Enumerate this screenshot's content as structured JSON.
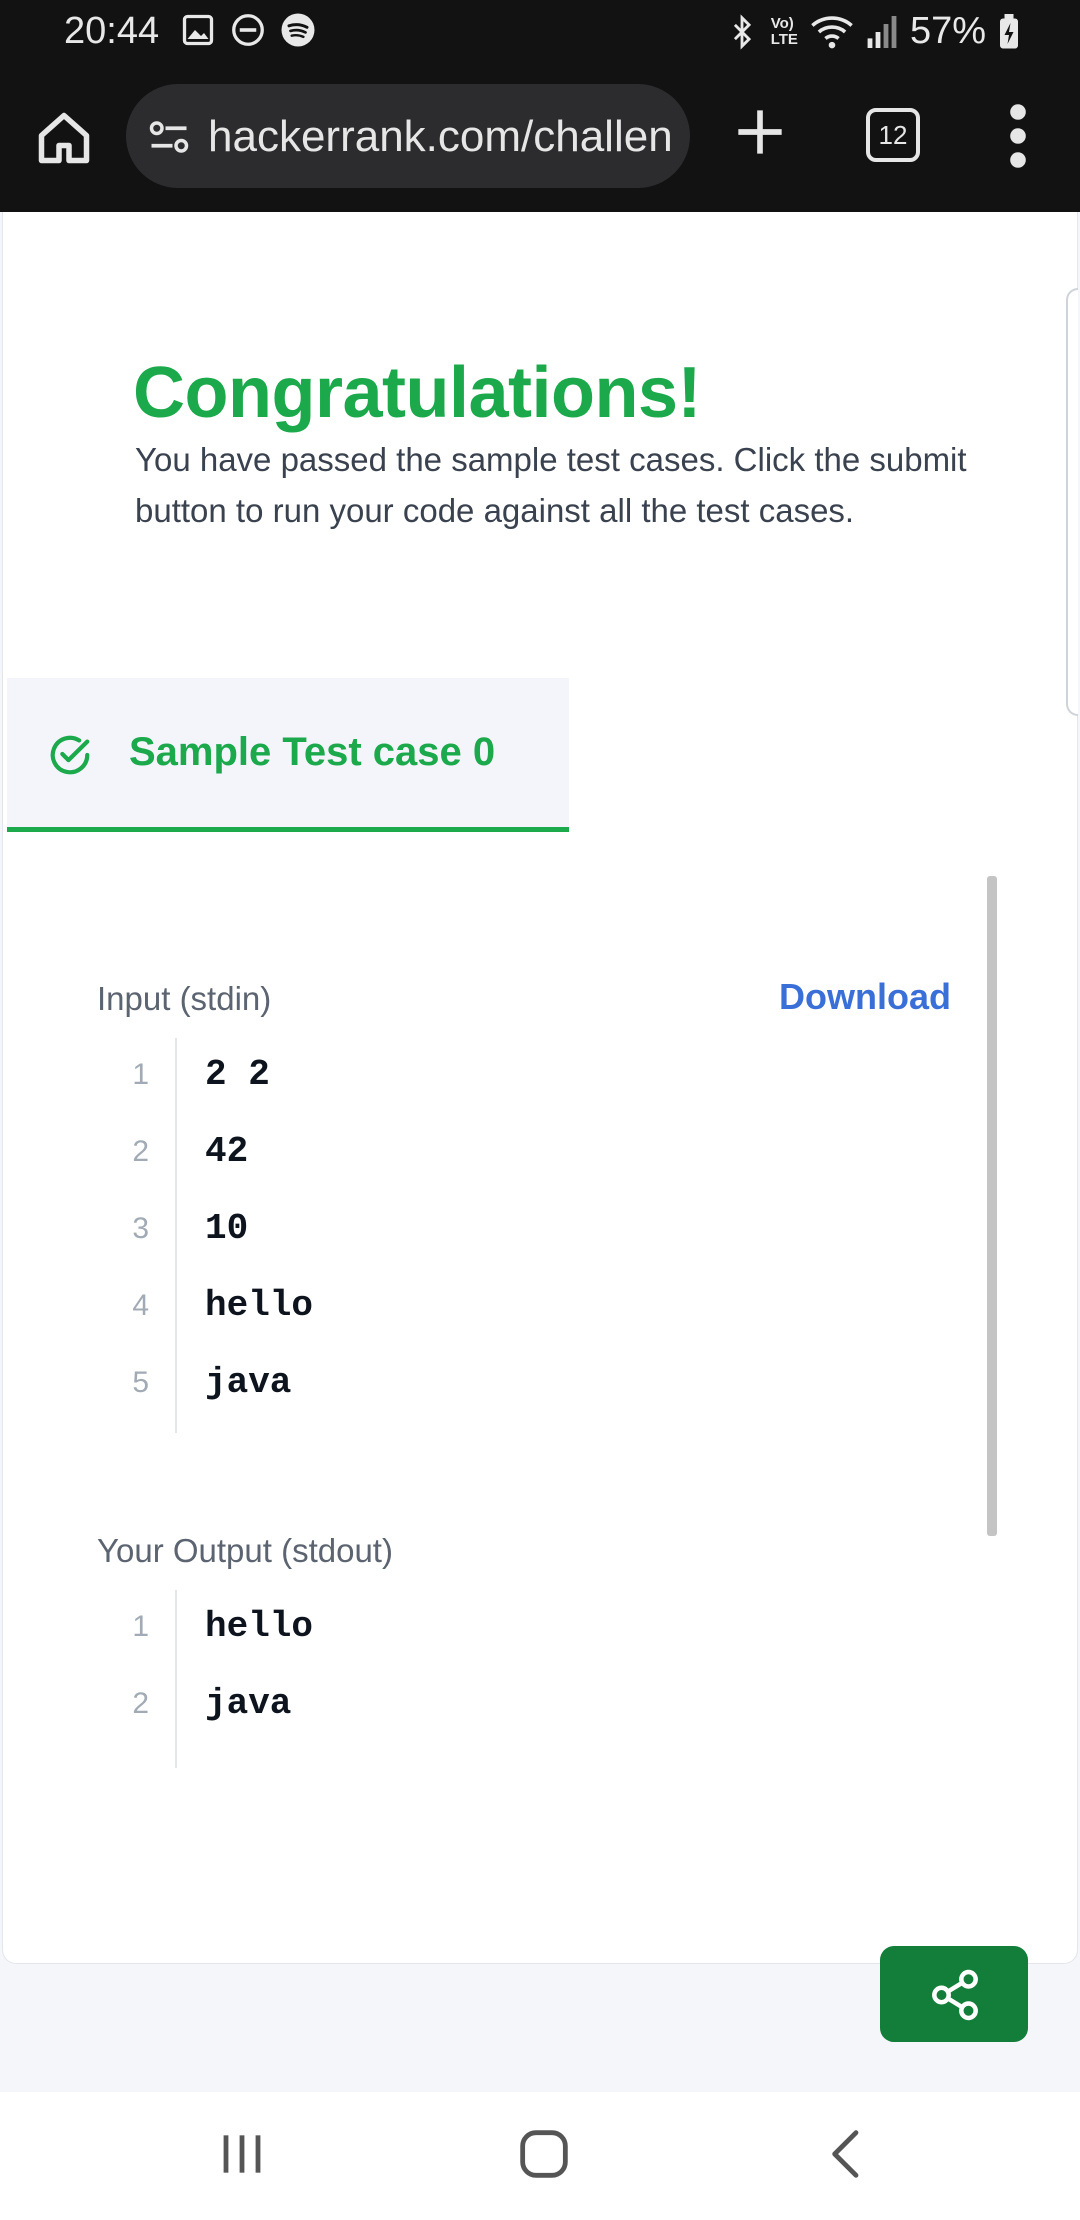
{
  "status_bar": {
    "time": "20:44",
    "network_label": "Vo)\nLTE",
    "battery": "57%"
  },
  "browser": {
    "url": "hackerrank.com/challen",
    "tab_count": "12"
  },
  "page": {
    "title": "Congratulations!",
    "message": "You have passed the sample test cases. Click the submit button to run your code against all the test cases.",
    "testcase_tab": "Sample Test case 0",
    "input_label": "Input (stdin)",
    "download_label": "Download",
    "output_label": "Your Output (stdout)",
    "input_lines": [
      {
        "no": "1",
        "code": "2 2"
      },
      {
        "no": "2",
        "code": "42"
      },
      {
        "no": "3",
        "code": "10"
      },
      {
        "no": "4",
        "code": "hello"
      },
      {
        "no": "5",
        "code": "java"
      }
    ],
    "output_lines": [
      {
        "no": "1",
        "code": "hello"
      },
      {
        "no": "2",
        "code": "java"
      }
    ]
  },
  "colors": {
    "success_green": "#1ba94c",
    "link_blue": "#3b6fd8",
    "fab_green": "#137e3a"
  },
  "icons": [
    "gallery-icon",
    "dnd-icon",
    "spotify-icon",
    "bluetooth-icon",
    "wifi-icon",
    "signal-icon",
    "battery-icon",
    "home-icon",
    "site-settings-icon",
    "plus-icon",
    "tabs-icon",
    "more-icon",
    "check-circle-icon",
    "share-icon",
    "recents-icon",
    "home-nav-icon",
    "back-icon"
  ]
}
